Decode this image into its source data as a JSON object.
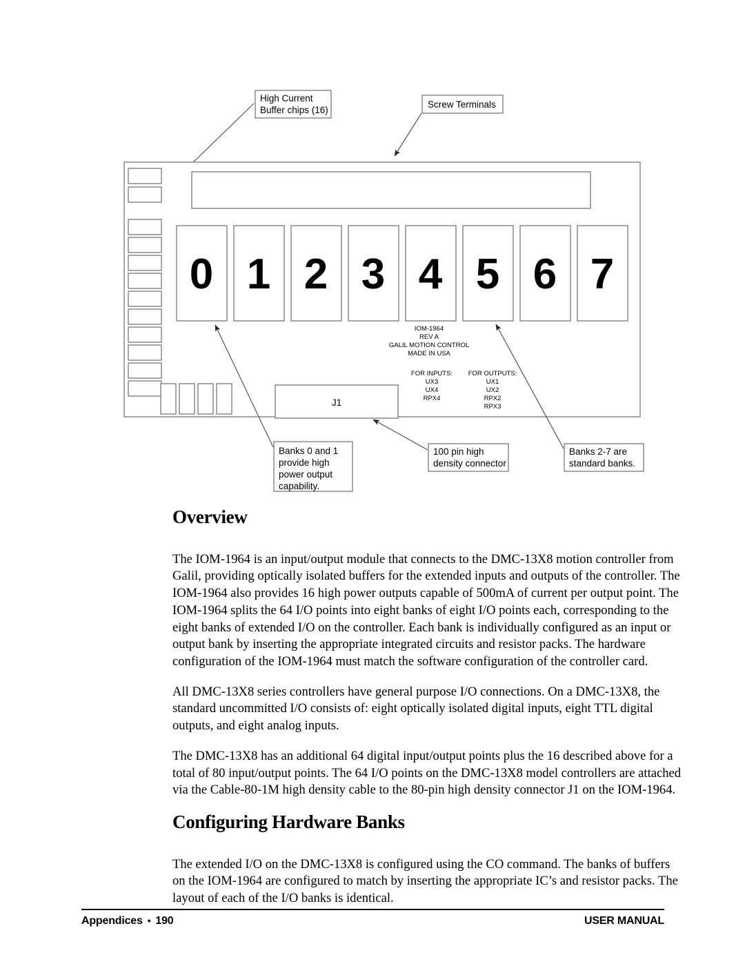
{
  "figure": {
    "callouts": {
      "high_current": [
        "High Current",
        "Buffer chips (16)"
      ],
      "screw_terminals": [
        "Screw Terminals"
      ],
      "banks01": [
        "Banks 0 and 1",
        "provide high",
        "power output",
        "capability."
      ],
      "connector": [
        "100 pin high",
        "density connector"
      ],
      "banks27": [
        "Banks 2-7 are",
        "standard banks."
      ]
    },
    "banks": [
      "0",
      "1",
      "2",
      "3",
      "4",
      "5",
      "6",
      "7"
    ],
    "connector_label": "J1",
    "silkscreen": {
      "title_lines": [
        "IOM-1964",
        "REV A",
        "GALIL MOTION CONTROL",
        "MADE IN USA"
      ],
      "inputs_header": "FOR INPUTS:",
      "inputs": [
        "UX3",
        "UX4",
        "RPX4"
      ],
      "outputs_header": "FOR OUTPUTS:",
      "outputs": [
        "UX1",
        "UX2",
        "RPX2",
        "RPX3"
      ]
    }
  },
  "sections": {
    "overview_heading": "Overview",
    "overview_p1": "The IOM-1964 is an input/output module that connects to the DMC-13X8 motion controller from Galil, providing optically isolated buffers for the extended inputs and outputs of the controller.  The IOM-1964 also provides 16 high power outputs capable of 500mA of current per output point.  The IOM-1964 splits the 64 I/O points into eight banks of eight I/O points each, corresponding to the eight banks of extended I/O on the controller.  Each bank is individually configured as an input or output bank by inserting the appropriate integrated circuits and resistor packs.  The hardware configuration of the IOM-1964 must match the software configuration of the controller card.",
    "overview_p2": "All DMC-13X8 series controllers have general purpose I/O connections.  On a DMC-13X8, the standard uncommitted I/O consists of: eight optically isolated digital inputs, eight TTL digital outputs, and eight analog inputs.",
    "overview_p3": "The DMC-13X8 has an additional 64 digital input/output points plus the 16 described above for a total of 80 input/output points.  The 64 I/O points on the DMC-13X8 model controllers are attached via the Cable-80-1M high density cable to the 80-pin high density connector J1 on the IOM-1964.",
    "configuring_heading": "Configuring Hardware Banks",
    "configuring_p1": "The extended I/O on the DMC-13X8 is configured using the CO command.  The banks of buffers on the IOM-1964 are configured to match by inserting the appropriate IC’s and resistor packs.  The layout of each of the I/O banks is identical."
  },
  "footer": {
    "section": "Appendices",
    "separator": "•",
    "page": "190",
    "manual": "USER MANUAL"
  }
}
